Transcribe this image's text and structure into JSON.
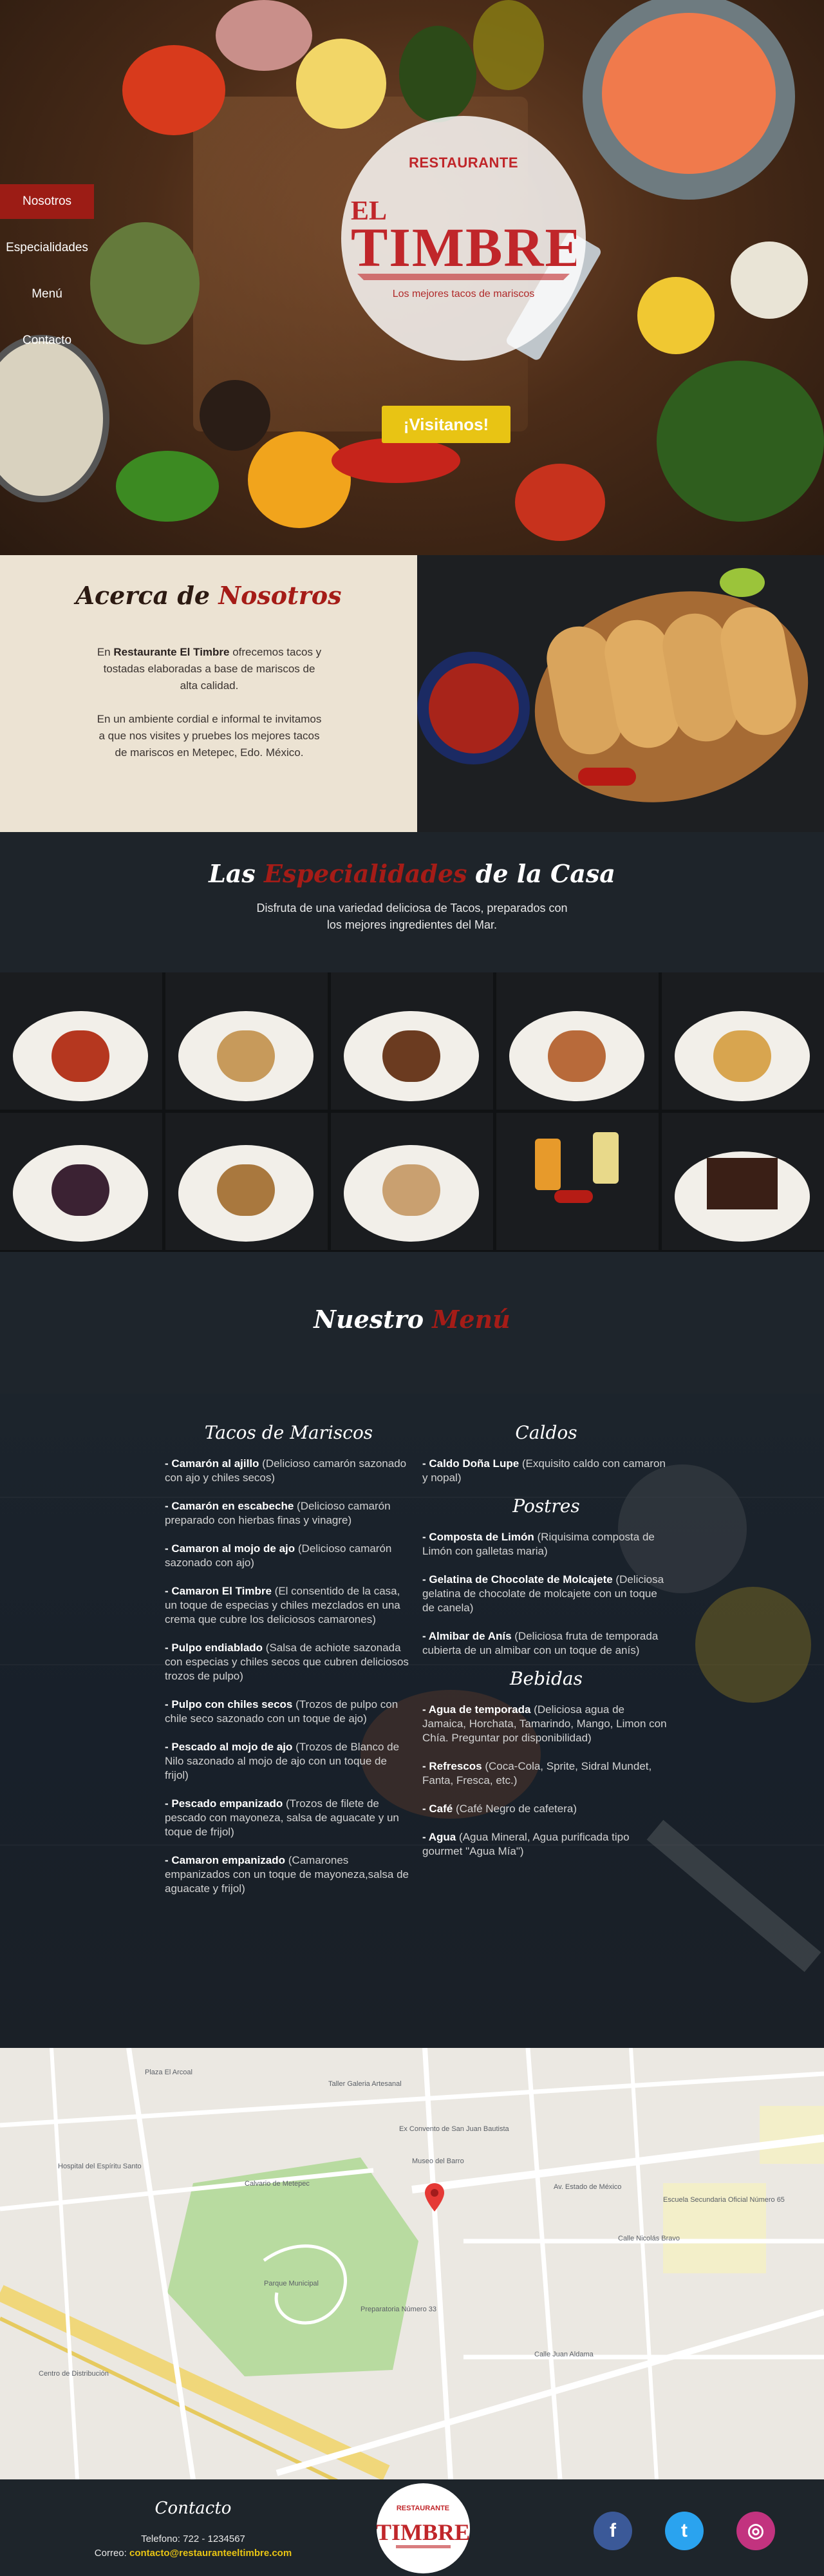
{
  "nav": {
    "items": [
      {
        "label": "Nosotros",
        "active": true
      },
      {
        "label": "Especialidades",
        "active": false
      },
      {
        "label": "Menú",
        "active": false
      },
      {
        "label": "Contacto",
        "active": false
      }
    ]
  },
  "hero": {
    "restaurant_label": "RESTAURANTE",
    "logo_line1": "EL",
    "logo_line2": "TIMBRE",
    "tagline": "Los mejores tacos de mariscos",
    "cta": "¡Visitanos!"
  },
  "about": {
    "title_part1": "Acerca de ",
    "title_part2": "Nosotros",
    "p1_prefix": "En ",
    "p1_bold": "Restaurante El Timbre",
    "p1_suffix": " ofrecemos tacos y tostadas elaboradas a base de mariscos de alta calidad.",
    "p2": "En un ambiente cordial e informal te invitamos a que nos visites y pruebes los mejores tacos de mariscos en Metepec, Edo. México."
  },
  "specialties": {
    "title_part1": "Las ",
    "title_part2": "Especialidades",
    "title_part3": " de la Casa",
    "subtitle": "Disfruta de una variedad deliciosa de Tacos, preparados con los mejores ingredientes del Mar."
  },
  "menu": {
    "title_part1": "Nuestro ",
    "title_part2": "Menú",
    "mariscos": {
      "title": "Tacos de Mariscos",
      "items": [
        {
          "name": "- Camarón al ajillo",
          "desc": " (Delicioso camarón sazonado con ajo y chiles secos)"
        },
        {
          "name": "- Camarón en escabeche",
          "desc": " (Delicioso camarón preparado con hierbas finas y vinagre)"
        },
        {
          "name": "- Camaron al mojo de ajo",
          "desc": " (Delicioso camarón sazonado con ajo)"
        },
        {
          "name": "- Camaron El Timbre",
          "desc": " (El consentido de la casa, un toque de especias y chiles mezclados en una crema que cubre los deliciosos camarones)"
        },
        {
          "name": "- Pulpo endiablado",
          "desc": " (Salsa de achiote sazonada con especias y chiles secos que cubren deliciosos trozos de pulpo)"
        },
        {
          "name": "- Pulpo con chiles secos",
          "desc": " (Trozos de pulpo con chile seco sazonado con un toque de ajo)"
        },
        {
          "name": "- Pescado al mojo de ajo",
          "desc": " (Trozos de Blanco de Nilo sazonado al mojo de ajo con un toque de frijol)"
        },
        {
          "name": "- Pescado empanizado",
          "desc": " (Trozos de filete de pescado con mayoneza, salsa de aguacate y un toque de frijol)"
        },
        {
          "name": "- Camaron empanizado",
          "desc": " (Camarones empanizados con un toque de mayoneza,salsa de aguacate y frijol)"
        }
      ]
    },
    "caldos": {
      "title": "Caldos",
      "items": [
        {
          "name": "- Caldo Doña Lupe",
          "desc": " (Exquisito caldo con camaron y nopal)"
        }
      ]
    },
    "postres": {
      "title": "Postres",
      "items": [
        {
          "name": "- Composta de Limón",
          "desc": " (Riquisima composta de Limón con galletas maria)"
        },
        {
          "name": "- Gelatina de Chocolate de Molcajete",
          "desc": " (Deliciosa gelatina de chocolate de molcajete con un toque de canela)"
        },
        {
          "name": "- Almibar de Anís",
          "desc": " (Deliciosa fruta de temporada cubierta de un almibar con un toque de anís)"
        }
      ]
    },
    "bebidas": {
      "title": "Bebidas",
      "items": [
        {
          "name": "- Agua de temporada",
          "desc": " (Deliciosa agua de Jamaica, Horchata, Tamarindo, Mango, Limon con Chía. Preguntar por disponibilidad)"
        },
        {
          "name": "- Refrescos",
          "desc": " (Coca-Cola, Sprite, Sidral Mundet, Fanta, Fresca, etc.)"
        },
        {
          "name": "- Café",
          "desc": " (Café Negro de cafetera)"
        },
        {
          "name": "- Agua",
          "desc": " (Agua Mineral, Agua purificada tipo gourmet \"Agua Mía\")"
        }
      ]
    }
  },
  "map": {
    "labels": [
      "Plaza El Arcoal",
      "Taller Galeria Artesanal",
      "Hospital del Espíritu Santo",
      "Ex Convento de San Juan Bautista",
      "Museo del Barro",
      "Calvario de Metepec",
      "Parque Municipal",
      "Preparatoria Número 33",
      "Centro de Distribución",
      "Av. Estado de México",
      "Calle Nicolás Bravo",
      "Escuela Secundaria Oficial Número 65",
      "Calle Juan Aldama"
    ]
  },
  "footer": {
    "contact_title": "Contacto",
    "phone": "Telefono: 722 - 1234567",
    "email_label": "Correo: ",
    "email": "contacto@restauranteeltimbre.com",
    "logo_line1": "RESTAURANTE",
    "logo_line2": "TIMBRE",
    "social": [
      {
        "name": "facebook",
        "glyph": "f",
        "color": "#3b5998"
      },
      {
        "name": "twitter",
        "glyph": "t",
        "color": "#2aa3ef"
      },
      {
        "name": "instagram",
        "glyph": "◎",
        "color": "#c2337f"
      }
    ]
  },
  "colors": {
    "accent_red": "#a51c17",
    "cta_yellow": "#e8c414",
    "dark_bg": "#1e252b"
  }
}
